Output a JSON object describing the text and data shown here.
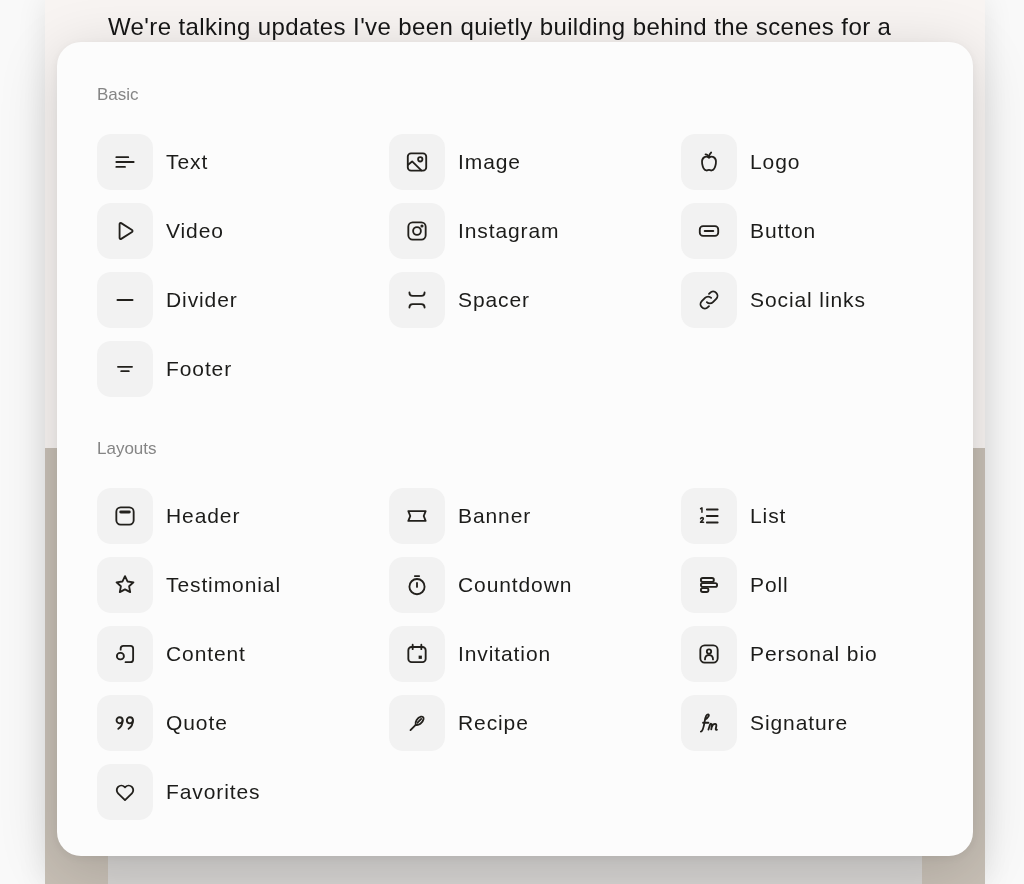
{
  "background": {
    "intro_text": "We're talking updates I've been quietly building behind the scenes for a"
  },
  "block_menu": {
    "sections": [
      {
        "title": "Basic",
        "items": [
          {
            "label": "Text"
          },
          {
            "label": "Image"
          },
          {
            "label": "Logo"
          },
          {
            "label": "Video"
          },
          {
            "label": "Instagram"
          },
          {
            "label": "Button"
          },
          {
            "label": "Divider"
          },
          {
            "label": "Spacer"
          },
          {
            "label": "Social links"
          },
          {
            "label": "Footer"
          }
        ]
      },
      {
        "title": "Layouts",
        "items": [
          {
            "label": "Header"
          },
          {
            "label": "Banner"
          },
          {
            "label": "List"
          },
          {
            "label": "Testimonial"
          },
          {
            "label": "Countdown"
          },
          {
            "label": "Poll"
          },
          {
            "label": "Content"
          },
          {
            "label": "Invitation"
          },
          {
            "label": "Personal bio"
          },
          {
            "label": "Quote"
          },
          {
            "label": "Recipe"
          },
          {
            "label": "Signature"
          },
          {
            "label": "Favorites"
          }
        ]
      }
    ]
  }
}
